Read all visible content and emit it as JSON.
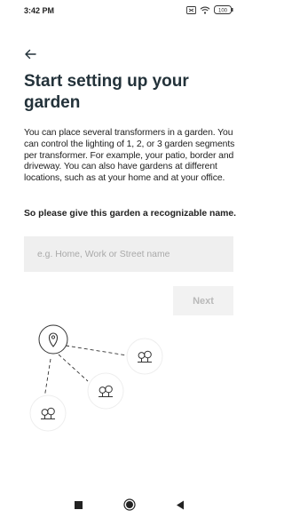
{
  "status": {
    "time": "3:42 PM",
    "battery": "100"
  },
  "icons": {
    "back": "arrow-left-icon",
    "signal": "signal-icon",
    "wifi": "wifi-icon",
    "battery": "battery-icon",
    "location": "location-pin-icon",
    "trees": "trees-icon",
    "nav_recent": "square-icon",
    "nav_home": "circle-icon",
    "nav_back": "triangle-left-icon"
  },
  "screen": {
    "title": "Start setting up your garden",
    "description": "You can place several transformers in a garden. You can control the lighting of 1, 2, or 3 garden segments per transformer. For example, your patio, border and driveway. You can also have gardens at different locations, such as at your home and at your office.",
    "prompt": "So please give this garden a recognizable name.",
    "input_placeholder": "e.g. Home, Work or Street name",
    "input_value": "",
    "next_label": "Next"
  },
  "colors": {
    "title": "#23323a",
    "input_bg": "#efefef",
    "button_disabled_bg": "#f2f2f2",
    "button_disabled_text": "#b9b9b9"
  }
}
